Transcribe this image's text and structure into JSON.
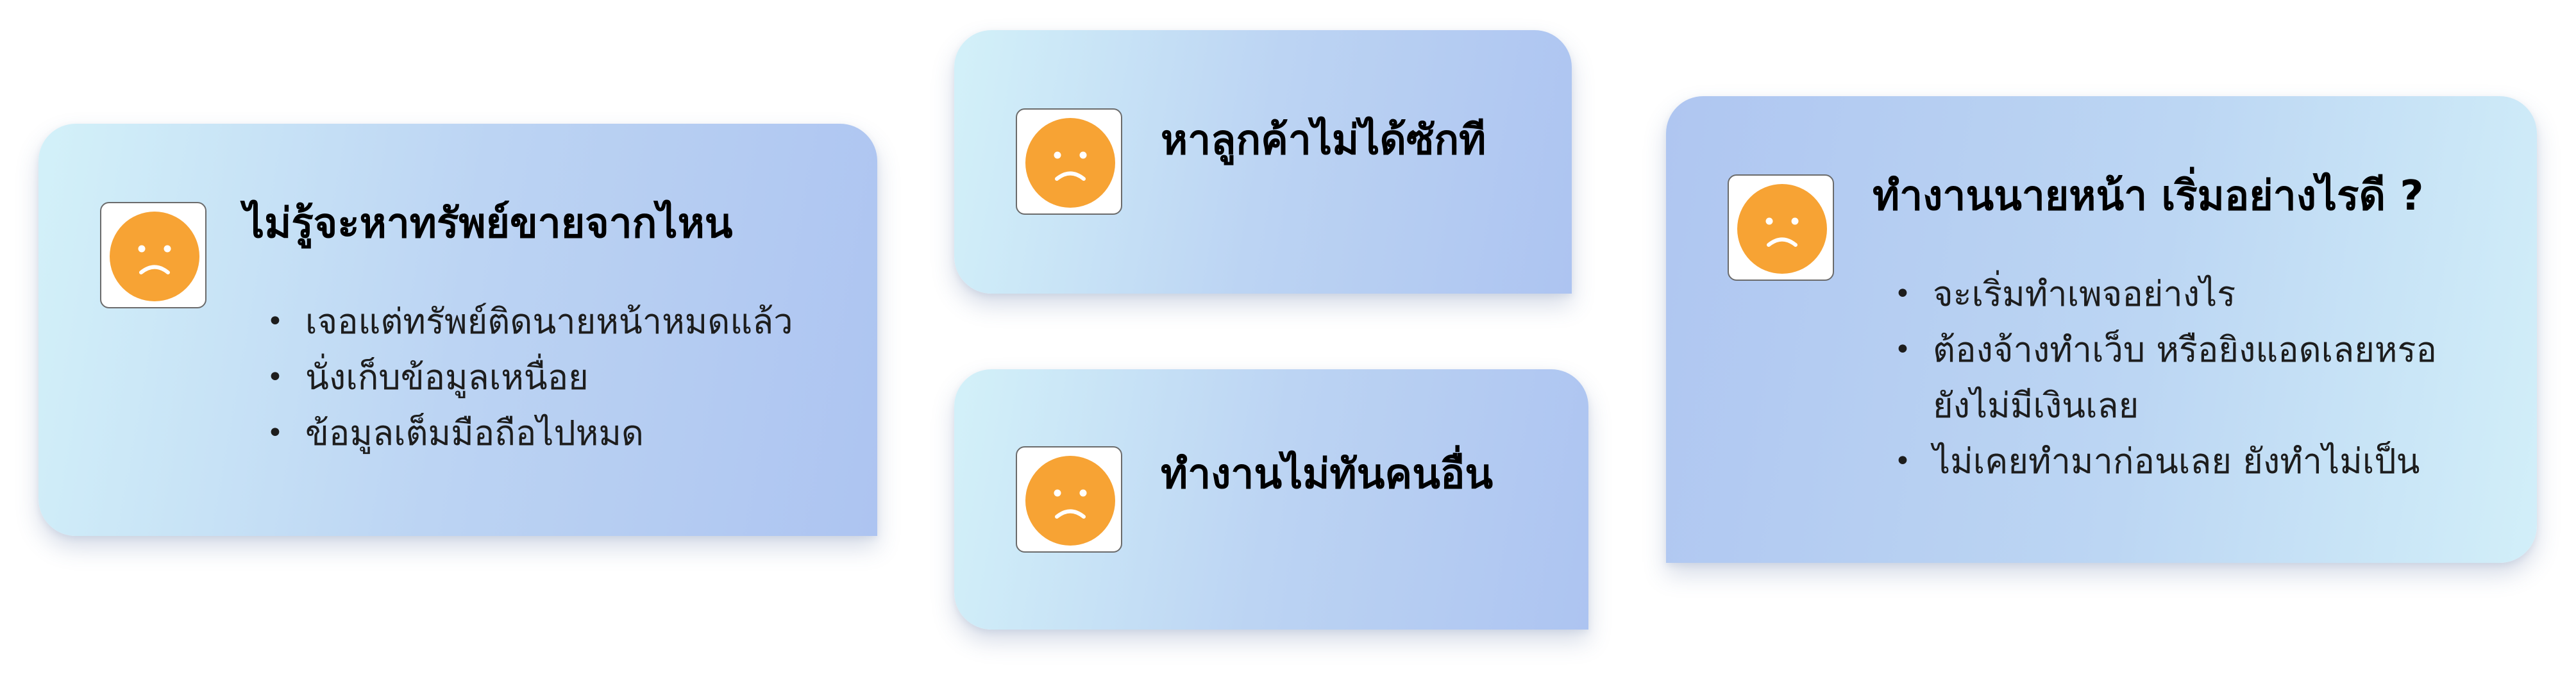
{
  "colors": {
    "face": "#f7a334",
    "gradient_light": "#d3f1f9",
    "gradient_dark": "#adc4f1"
  },
  "cards": [
    {
      "icon": "sad-face-icon",
      "title": "ไม่รู้จะหาทรัพย์ขายจากไหน",
      "bullets": [
        "เจอแต่ทรัพย์ติดนายหน้าหมดแล้ว",
        "นั่งเก็บข้อมูลเหนื่อย",
        "ข้อมูลเต็มมือถือไปหมด"
      ]
    },
    {
      "icon": "sad-face-icon",
      "title": "หาลูกค้าไม่ได้ซักที"
    },
    {
      "icon": "sad-face-icon",
      "title": "ทำงานไม่ทันคนอื่น"
    },
    {
      "icon": "sad-face-icon",
      "title": "ทำงานนายหน้า เริ่มอย่างไรดี ?",
      "bullets": [
        "จะเริ่มทำเพจอย่างไร",
        "ต้องจ้างทำเว็บ หรือยิงแอดเลยหรอ ยังไม่มีเงินเลย",
        "ไม่เคยทำมาก่อนเลย ยังทำไม่เป็น"
      ]
    }
  ]
}
